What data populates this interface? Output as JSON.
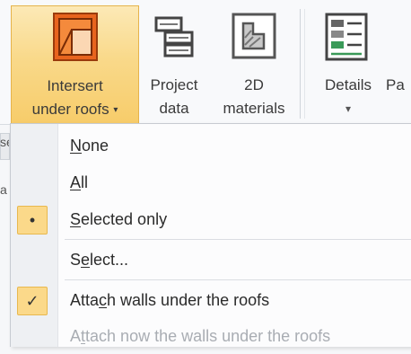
{
  "ribbon": {
    "intersect": {
      "line1": "Intersert",
      "line2": "under roofs",
      "caret": "▾",
      "icon": "roof-intersect-icon"
    },
    "project_data": {
      "line1": "Project",
      "line2": "data",
      "icon": "project-data-icon"
    },
    "materials_2d": {
      "line1": "2D",
      "line2": "materials",
      "icon": "2d-materials-icon"
    },
    "details": {
      "line1": "Details",
      "caret": "▾",
      "icon": "details-icon"
    },
    "next": {
      "line1": "Pa"
    },
    "left_edge": {
      "top": "se",
      "middle": "a"
    }
  },
  "menu": {
    "items": [
      {
        "pre": "",
        "key": "N",
        "post": "one",
        "state": "none"
      },
      {
        "pre": "",
        "key": "A",
        "post": "ll",
        "state": "none"
      },
      {
        "pre": "",
        "key": "S",
        "post": "elected only",
        "state": "selected",
        "mark": "•"
      },
      {
        "pre": "S",
        "key": "e",
        "post": "lect...",
        "state": "none"
      },
      {
        "pre": "Atta",
        "key": "c",
        "post": "h walls under the roofs",
        "state": "checked",
        "mark": "✓"
      },
      {
        "pre": "A",
        "key": "t",
        "post": "tach now the walls under the roofs",
        "state": "disabled"
      }
    ]
  },
  "colors": {
    "active_button": "#f9d98a",
    "icon_orange": "#e8641e",
    "check_highlight": "#fbd98a"
  }
}
